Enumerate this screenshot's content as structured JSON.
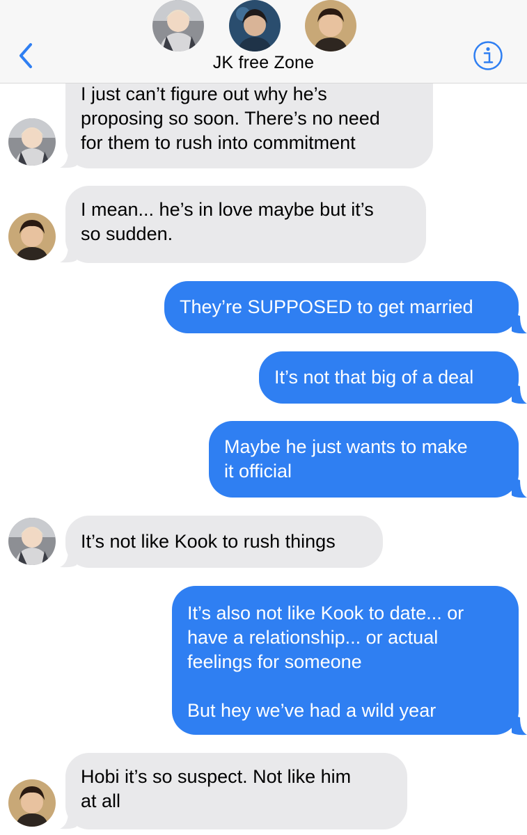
{
  "header": {
    "title": "JK free Zone",
    "back_icon": "chevron-left-icon",
    "info_icon": "info-circle-icon",
    "accent": "#2f7ff2",
    "avatars": [
      "group-member-avatar-1",
      "group-member-avatar-2",
      "group-member-avatar-3"
    ]
  },
  "messages": [
    {
      "direction": "incoming",
      "sender_avatar": "avatar-1",
      "lines": [
        "I just can’t figure out why he’s",
        "proposing so soon. There’s no need",
        "for them to rush into commitment"
      ]
    },
    {
      "direction": "incoming",
      "sender_avatar": "avatar-3",
      "lines": [
        "I mean... he’s in love maybe but it’s",
        "so sudden."
      ]
    },
    {
      "direction": "outgoing",
      "lines": [
        "They’re SUPPOSED to get married"
      ]
    },
    {
      "direction": "outgoing",
      "lines": [
        "It’s not that big of a deal"
      ]
    },
    {
      "direction": "outgoing",
      "lines": [
        "Maybe he just wants to make",
        "it official"
      ]
    },
    {
      "direction": "incoming",
      "sender_avatar": "avatar-1",
      "lines": [
        "It’s not like Kook to rush things"
      ]
    },
    {
      "direction": "outgoing",
      "lines": [
        "It’s also not like Kook to date... or",
        "have a relationship... or actual",
        "feelings for someone",
        "",
        "But hey we’ve had a wild year"
      ]
    },
    {
      "direction": "incoming",
      "sender_avatar": "avatar-3",
      "lines": [
        "Hobi it’s so suspect. Not like him",
        "at all"
      ]
    }
  ],
  "colors": {
    "incoming_bubble": "#e9e9eb",
    "outgoing_bubble": "#2f7ff2",
    "header_bg": "#f7f7f7"
  }
}
